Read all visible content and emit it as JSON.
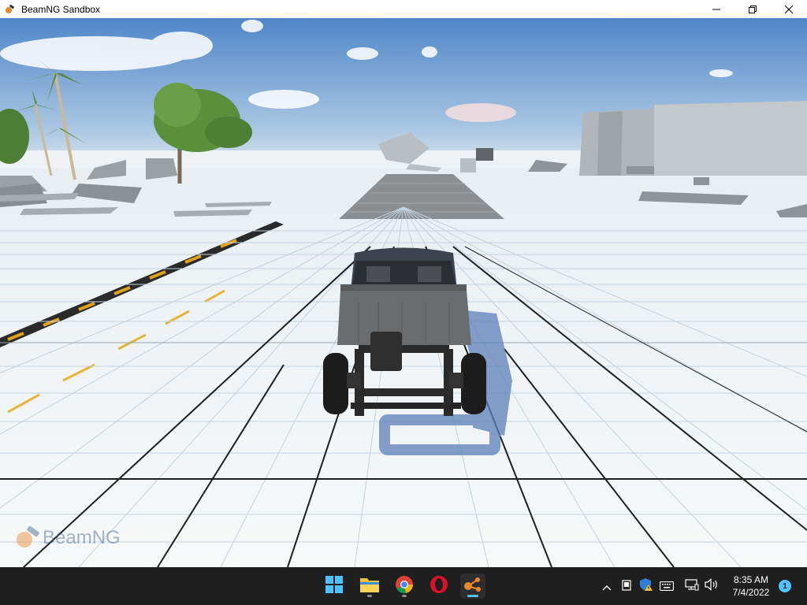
{
  "window": {
    "title": "BeamNG Sandbox",
    "controls": {
      "minimize_icon": "minimize-icon",
      "maximize_icon": "restore-icon",
      "close_icon": "close-icon"
    }
  },
  "game": {
    "watermark": "BeamNG",
    "colors": {
      "sky_top": "#4f86c8",
      "sky_horizon": "#dfe7ee",
      "ground": "#f4f6f6",
      "grid_minor": "#c9d7e3",
      "grid_major": "#1b1b1b",
      "hazard_yellow": "#e0a21c",
      "vehicle_body": "#666666"
    }
  },
  "taskbar": {
    "apps": [
      {
        "name": "windows-start-icon",
        "active": false
      },
      {
        "name": "file-explorer-icon",
        "active": false
      },
      {
        "name": "chrome-icon",
        "active": false
      },
      {
        "name": "opera-icon",
        "active": false
      },
      {
        "name": "beamng-icon",
        "active": true
      }
    ],
    "tray": {
      "icons": [
        "chevron-up-icon",
        "app-tray-icon",
        "security-warning-icon",
        "keyboard-icon",
        "network-icon",
        "volume-icon"
      ],
      "time": "8:35 AM",
      "date": "7/4/2022",
      "notification_count": "1"
    }
  }
}
